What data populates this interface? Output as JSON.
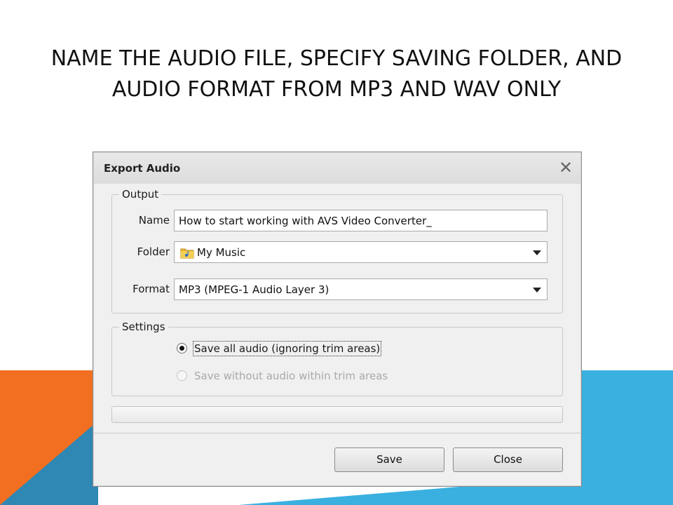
{
  "slide": {
    "title": "NAME THE AUDIO FILE, SPECIFY SAVING FOLDER, AND AUDIO FORMAT FROM MP3 AND WAV ONLY",
    "colors": {
      "orange": "#f26f21",
      "blue": "#3ab0e0",
      "dark_blue": "#2f87b3"
    }
  },
  "dialog": {
    "title": "Export Audio",
    "close_icon": "close-icon",
    "output": {
      "legend": "Output",
      "name_label": "Name",
      "name_value": "How to start working with AVS Video Converter_",
      "folder_label": "Folder",
      "folder_value": "My Music",
      "folder_icon": "music-folder-icon",
      "format_label": "Format",
      "format_value": "MP3 (MPEG-1 Audio Layer 3)"
    },
    "settings": {
      "legend": "Settings",
      "options": [
        {
          "label": "Save all audio (ignoring trim areas)",
          "selected": true,
          "enabled": true
        },
        {
          "label": "Save without audio within trim areas",
          "selected": false,
          "enabled": false
        }
      ]
    },
    "progress": 0,
    "buttons": {
      "save": "Save",
      "close": "Close"
    }
  }
}
